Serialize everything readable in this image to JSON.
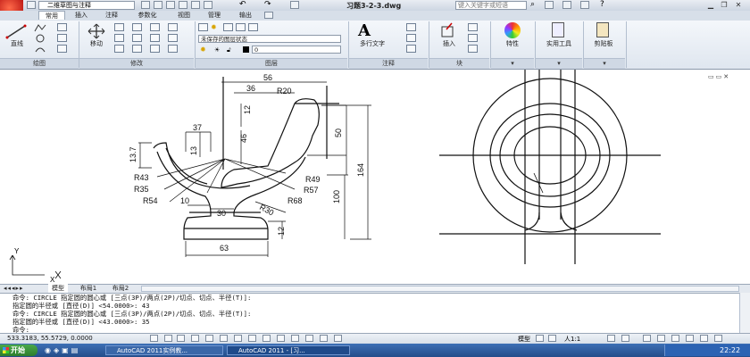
{
  "titlebar": {
    "workspace": "二维草图与注释",
    "document_title": "习题3-2-3.dwg",
    "search_placeholder": "键入关键字或短语"
  },
  "tabs": [
    "常用",
    "插入",
    "注释",
    "参数化",
    "视图",
    "管理",
    "输出"
  ],
  "active_tab": "常用",
  "ribbon": {
    "draw": {
      "line_label": "直线",
      "panel": "绘图"
    },
    "modify": {
      "move_label": "移动",
      "panel": "修改"
    },
    "layers": {
      "layer_state": "未保存的图层状态",
      "layer_value": "0",
      "panel": "图层"
    },
    "annotation": {
      "mtext_label": "多行文字",
      "panel": "注释"
    },
    "block": {
      "insert_label": "插入",
      "panel": "块"
    },
    "properties": {
      "label": "特性"
    },
    "utilities": {
      "label": "实用工具"
    },
    "clipboard": {
      "label": "剪贴板"
    }
  },
  "drawing": {
    "dims": [
      "56",
      "36",
      "R20",
      "12",
      "46",
      "50",
      "164",
      "100",
      "37",
      "13",
      "13.7",
      "R43",
      "R35",
      "R54",
      "R49",
      "R57",
      "R68",
      "R30",
      "10",
      "30",
      "12",
      "63"
    ],
    "ucs_y": "Y",
    "ucs_x": "X"
  },
  "model_tabs": [
    "模型",
    "布局1",
    "布局2"
  ],
  "command_lines": [
    "命令:  CIRCLE 指定圆的圆心或 [三点(3P)/两点(2P)/切点、切点、半径(T)]:",
    "指定圆的半径或 [直径(D)] <54.0000>: 43",
    "命令:  CIRCLE 指定圆的圆心或 [三点(3P)/两点(2P)/切点、切点、半径(T)]:",
    "指定圆的半径或 [直径(D)] <43.0000>: 35",
    "命令:"
  ],
  "status": {
    "coords": "533.3183, 55.5729, 0.0000",
    "model": "模型",
    "scale": "人1:1"
  },
  "taskbar": {
    "start": "开始",
    "tasks": [
      "AutoCAD 2011实例教...",
      "AutoCAD 2011 - [习..."
    ],
    "clock": "22:22"
  }
}
